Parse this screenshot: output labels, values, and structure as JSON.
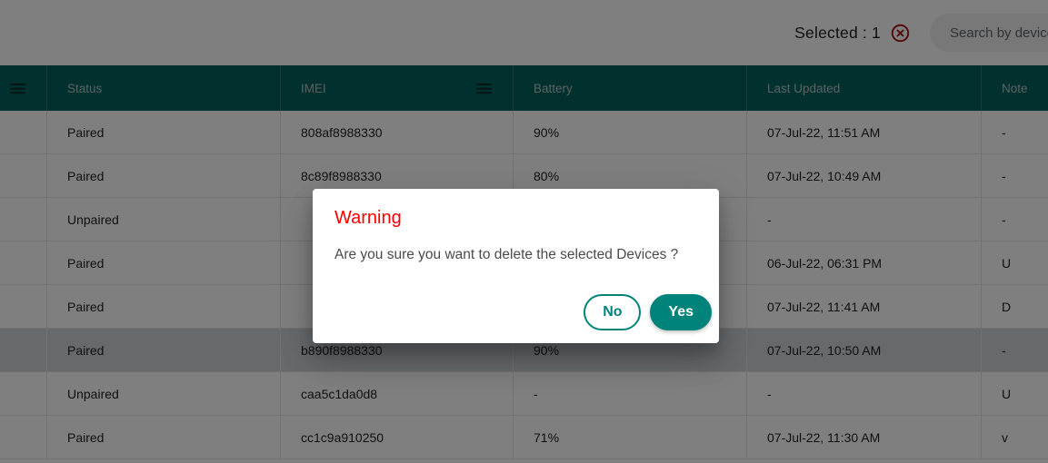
{
  "toolbar": {
    "selected_label": "Selected : 1",
    "clear_selection_icon": "close-circle-icon",
    "search_placeholder": "Search by device I",
    "search_value": ""
  },
  "table": {
    "header_menu_icon": "hamburger-menu-icon",
    "imei_menu_icon": "hamburger-menu-icon",
    "columns": [
      {
        "key": "select",
        "label": ""
      },
      {
        "key": "status",
        "label": "Status"
      },
      {
        "key": "imei",
        "label": "IMEI"
      },
      {
        "key": "battery",
        "label": "Battery"
      },
      {
        "key": "updated",
        "label": "Last Updated"
      },
      {
        "key": "note",
        "label": "Note"
      }
    ],
    "rows": [
      {
        "status": "Paired",
        "imei": "808af8988330",
        "battery": "90%",
        "updated": "07-Jul-22, 11:51 AM",
        "note": "-",
        "selected": false
      },
      {
        "status": "Paired",
        "imei": "8c89f8988330",
        "battery": "80%",
        "updated": "07-Jul-22, 10:49 AM",
        "note": "-",
        "selected": false
      },
      {
        "status": "Unpaired",
        "imei": "",
        "battery": "",
        "updated": "-",
        "note": "-",
        "selected": false
      },
      {
        "status": "Paired",
        "imei": "",
        "battery": "",
        "updated": "06-Jul-22, 06:31 PM",
        "note": "U",
        "selected": false
      },
      {
        "status": "Paired",
        "imei": "",
        "battery": "",
        "updated": "07-Jul-22, 11:41 AM",
        "note": "D",
        "selected": false
      },
      {
        "status": "Paired",
        "imei": "b890f8988330",
        "battery": "90%",
        "updated": "07-Jul-22, 10:50 AM",
        "note": "-",
        "selected": true
      },
      {
        "status": "Unpaired",
        "imei": "caa5c1da0d8",
        "battery": "-",
        "updated": "-",
        "note": "U",
        "selected": false
      },
      {
        "status": "Paired",
        "imei": "cc1c9a910250",
        "battery": "71%",
        "updated": "07-Jul-22, 11:30 AM",
        "note": "v",
        "selected": false
      }
    ]
  },
  "dialog": {
    "title": "Warning",
    "message": "Are you sure you want to delete the selected Devices ?",
    "no_label": "No",
    "yes_label": "Yes"
  },
  "colors": {
    "header_teal": "#00635d",
    "accent_teal": "#00837b",
    "warning_red": "#ff0000",
    "clear_icon_red": "#a81414",
    "selected_row": "#ced4da"
  }
}
